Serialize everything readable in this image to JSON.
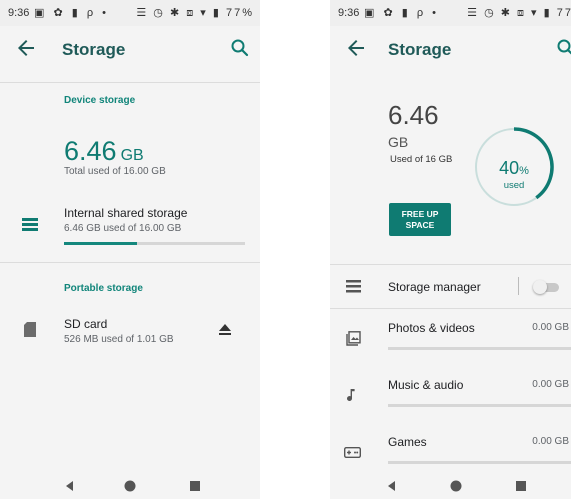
{
  "status": {
    "time": "9:36",
    "battery_left": "77%",
    "battery_right": "77",
    "left_icons": "▣ ✿ ▮ ρ •",
    "right_icons": "☰ ◷ ✱ ⧈ ▾ ▮"
  },
  "left": {
    "title": "Storage",
    "device_section": "Device storage",
    "used_value": "6.46",
    "used_unit": "GB",
    "total_used": "Total used of 16.00 GB",
    "internal": {
      "title": "Internal shared storage",
      "subtitle": "6.46 GB used of 16.00 GB",
      "progress": 0.404
    },
    "portable_section": "Portable storage",
    "sd": {
      "title": "SD card",
      "subtitle": "526 MB used of 1.01 GB"
    }
  },
  "right": {
    "title": "Storage",
    "used_value": "6.46",
    "used_unit": "GB",
    "used_of": "Used of 16 GB",
    "gauge_percent": "40",
    "gauge_percent_sign": "%",
    "gauge_label": "used",
    "gauge_fraction": 0.4,
    "free_button": [
      "FREE UP",
      "SPACE"
    ],
    "storage_manager": "Storage manager",
    "categories": [
      {
        "title": "Photos & videos",
        "size": "0.00 GB",
        "icon": "photo-icon"
      },
      {
        "title": "Music & audio",
        "size": "0.00 GB",
        "icon": "music-note-icon"
      },
      {
        "title": "Games",
        "size": "0.00 GB",
        "icon": "gamepad-icon"
      }
    ]
  },
  "colors": {
    "accent": "#0f7b72",
    "title": "#1f5a58",
    "track": "#d6d6d6"
  }
}
